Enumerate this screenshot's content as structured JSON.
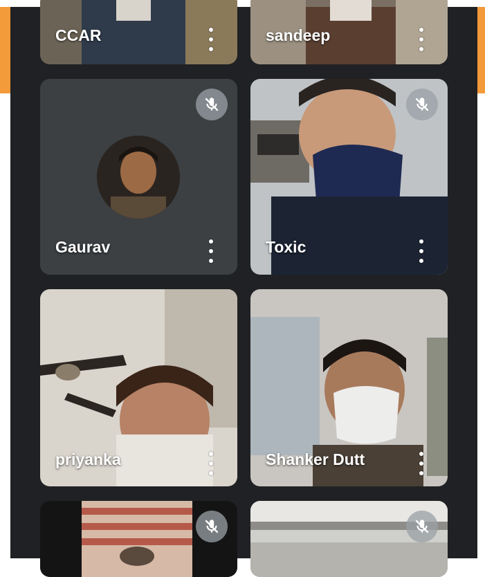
{
  "participants": [
    {
      "name": "CCAR",
      "video": true,
      "muted": false
    },
    {
      "name": "sandeep",
      "video": true,
      "muted": false
    },
    {
      "name": "Gaurav",
      "video": false,
      "muted": true
    },
    {
      "name": "Toxic",
      "video": true,
      "muted": true
    },
    {
      "name": "priyanka",
      "video": true,
      "muted": false
    },
    {
      "name": "Shanker Dutt",
      "video": true,
      "muted": false
    },
    {
      "name": "",
      "video": true,
      "muted": true
    },
    {
      "name": "",
      "video": true,
      "muted": true
    }
  ],
  "colors": {
    "frame_accent": "#f39a3b",
    "background": "#202124",
    "tile_background": "#3c4043",
    "muted_badge": "#9aa0a6"
  },
  "icons": {
    "muted": "mic-off-icon",
    "options": "more-vert-icon"
  }
}
